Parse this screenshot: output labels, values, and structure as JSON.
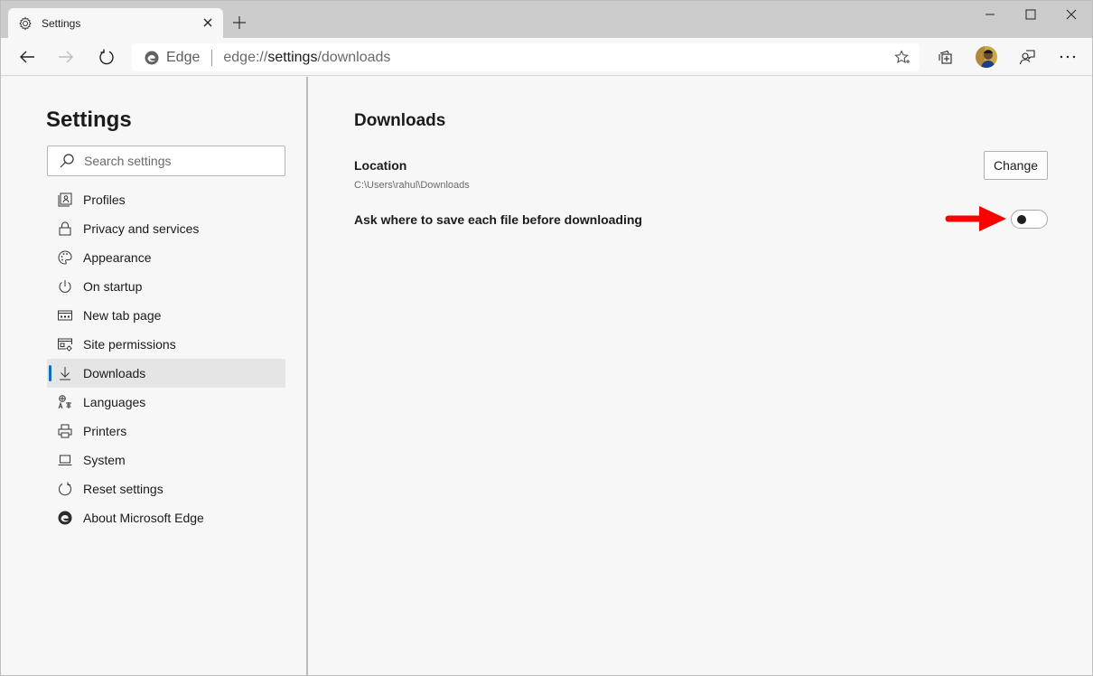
{
  "window": {
    "tab_title": "Settings",
    "controls": [
      "minimize",
      "maximize",
      "close"
    ]
  },
  "toolbar": {
    "site_label": "Edge",
    "url_prefix": "edge://",
    "url_host": "settings",
    "url_path": "/downloads",
    "icons": [
      "back-icon",
      "forward-icon",
      "refresh-icon",
      "favorite-icon",
      "collections-icon",
      "profile-avatar",
      "feedback-icon",
      "more-icon"
    ]
  },
  "sidebar": {
    "title": "Settings",
    "search_placeholder": "Search settings",
    "items": [
      {
        "label": "Profiles",
        "icon": "profiles-icon",
        "active": false
      },
      {
        "label": "Privacy and services",
        "icon": "lock-icon",
        "active": false
      },
      {
        "label": "Appearance",
        "icon": "palette-icon",
        "active": false
      },
      {
        "label": "On startup",
        "icon": "power-icon",
        "active": false
      },
      {
        "label": "New tab page",
        "icon": "new-tab-icon",
        "active": false
      },
      {
        "label": "Site permissions",
        "icon": "site-permissions-icon",
        "active": false
      },
      {
        "label": "Downloads",
        "icon": "download-icon",
        "active": true
      },
      {
        "label": "Languages",
        "icon": "languages-icon",
        "active": false
      },
      {
        "label": "Printers",
        "icon": "printer-icon",
        "active": false
      },
      {
        "label": "System",
        "icon": "laptop-icon",
        "active": false
      },
      {
        "label": "Reset settings",
        "icon": "reset-icon",
        "active": false
      },
      {
        "label": "About Microsoft Edge",
        "icon": "edge-logo-icon",
        "active": false
      }
    ]
  },
  "main": {
    "heading": "Downloads",
    "location_label": "Location",
    "location_path": "C:\\Users\\rahul\\Downloads",
    "change_button": "Change",
    "ask_label": "Ask where to save each file before downloading",
    "ask_toggle_on": false,
    "annotation": "red-arrow pointing at toggle"
  },
  "colors": {
    "accent": "#0f6cbd",
    "arrow": "#ff0000",
    "background": "#f7f7f7",
    "tabstrip": "#cccccc"
  }
}
